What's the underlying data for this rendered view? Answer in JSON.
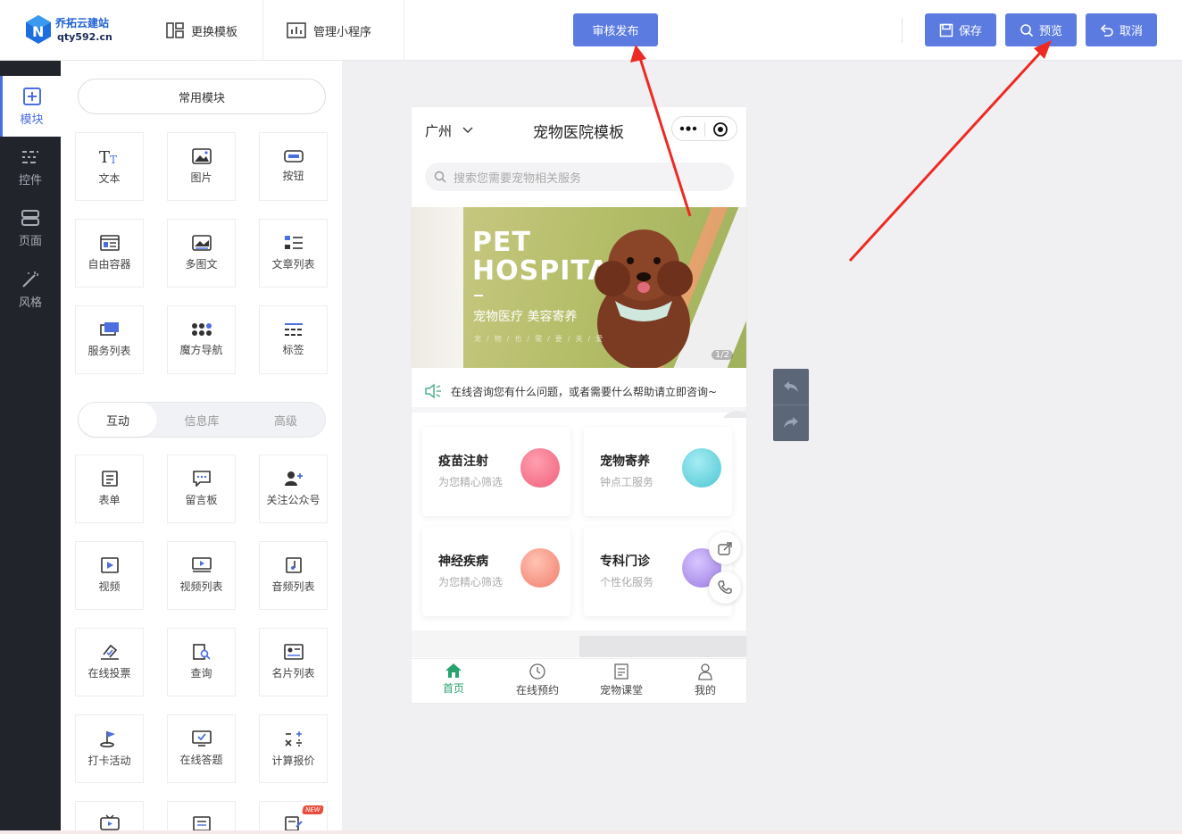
{
  "header": {
    "brand": "乔拓云建站",
    "url": "qty592.cn",
    "change_template": "更换模板",
    "manage_miniapp": "管理小程序",
    "publish": "审核发布",
    "save": "保存",
    "preview": "预览",
    "cancel": "取消"
  },
  "leftnav": {
    "items": [
      {
        "label": "模块",
        "icon": "plus-square-icon"
      },
      {
        "label": "控件",
        "icon": "sliders-icon"
      },
      {
        "label": "页面",
        "icon": "pages-icon"
      },
      {
        "label": "风格",
        "icon": "magic-wand-icon"
      }
    ]
  },
  "panel": {
    "common_modules": "常用模块",
    "common": [
      {
        "label": "文本",
        "icon": "text-icon"
      },
      {
        "label": "图片",
        "icon": "image-icon"
      },
      {
        "label": "按钮",
        "icon": "button-icon"
      },
      {
        "label": "自由容器",
        "icon": "container-icon"
      },
      {
        "label": "多图文",
        "icon": "multi-image-icon"
      },
      {
        "label": "文章列表",
        "icon": "article-list-icon"
      },
      {
        "label": "服务列表",
        "icon": "service-list-icon"
      },
      {
        "label": "魔方导航",
        "icon": "grid-nav-icon"
      },
      {
        "label": "标签",
        "icon": "tag-icon"
      }
    ],
    "tabs": [
      "互动",
      "信息库",
      "高级"
    ],
    "interactive": [
      {
        "label": "表单",
        "icon": "form-icon"
      },
      {
        "label": "留言板",
        "icon": "message-board-icon"
      },
      {
        "label": "关注公众号",
        "icon": "follow-icon"
      },
      {
        "label": "视频",
        "icon": "video-icon"
      },
      {
        "label": "视频列表",
        "icon": "video-list-icon"
      },
      {
        "label": "音频列表",
        "icon": "audio-list-icon"
      },
      {
        "label": "在线投票",
        "icon": "vote-icon"
      },
      {
        "label": "查询",
        "icon": "query-icon"
      },
      {
        "label": "名片列表",
        "icon": "card-list-icon"
      },
      {
        "label": "打卡活动",
        "icon": "checkin-flag-icon"
      },
      {
        "label": "在线答题",
        "icon": "quiz-icon"
      },
      {
        "label": "计算报价",
        "icon": "calculator-icon"
      }
    ],
    "new_badge": "NEW"
  },
  "phone": {
    "city": "广州",
    "title": "宠物医院模板",
    "search_placeholder": "搜索您需要宠物相关服务",
    "banner": {
      "line1": "PET",
      "line2": "HOSPITAL",
      "subtitle": "宠物医疗 美容寄养",
      "tiny": "宠/物/也/需/要/关/爱",
      "counter": "1/2"
    },
    "notice": "在线咨询您有什么问题，或者需要什么帮助请立即咨询~",
    "services": [
      {
        "title": "疫苗注射",
        "desc": "为您精心筛选",
        "color": "#f4748a"
      },
      {
        "title": "宠物寄养",
        "desc": "钟点工服务",
        "color": "#6fd3de"
      },
      {
        "title": "神经疾病",
        "desc": "为您精心筛选",
        "color": "#f59a86"
      },
      {
        "title": "专科门诊",
        "desc": "个性化服务",
        "color": "#a98ce6"
      }
    ],
    "tabbar": [
      "首页",
      "在线预约",
      "宠物课堂",
      "我的"
    ]
  },
  "colors": {
    "accent": "#5b7be0",
    "nav_bg": "#22242c",
    "tab_active": "#27a36d",
    "arrow": "#ee2a24"
  }
}
